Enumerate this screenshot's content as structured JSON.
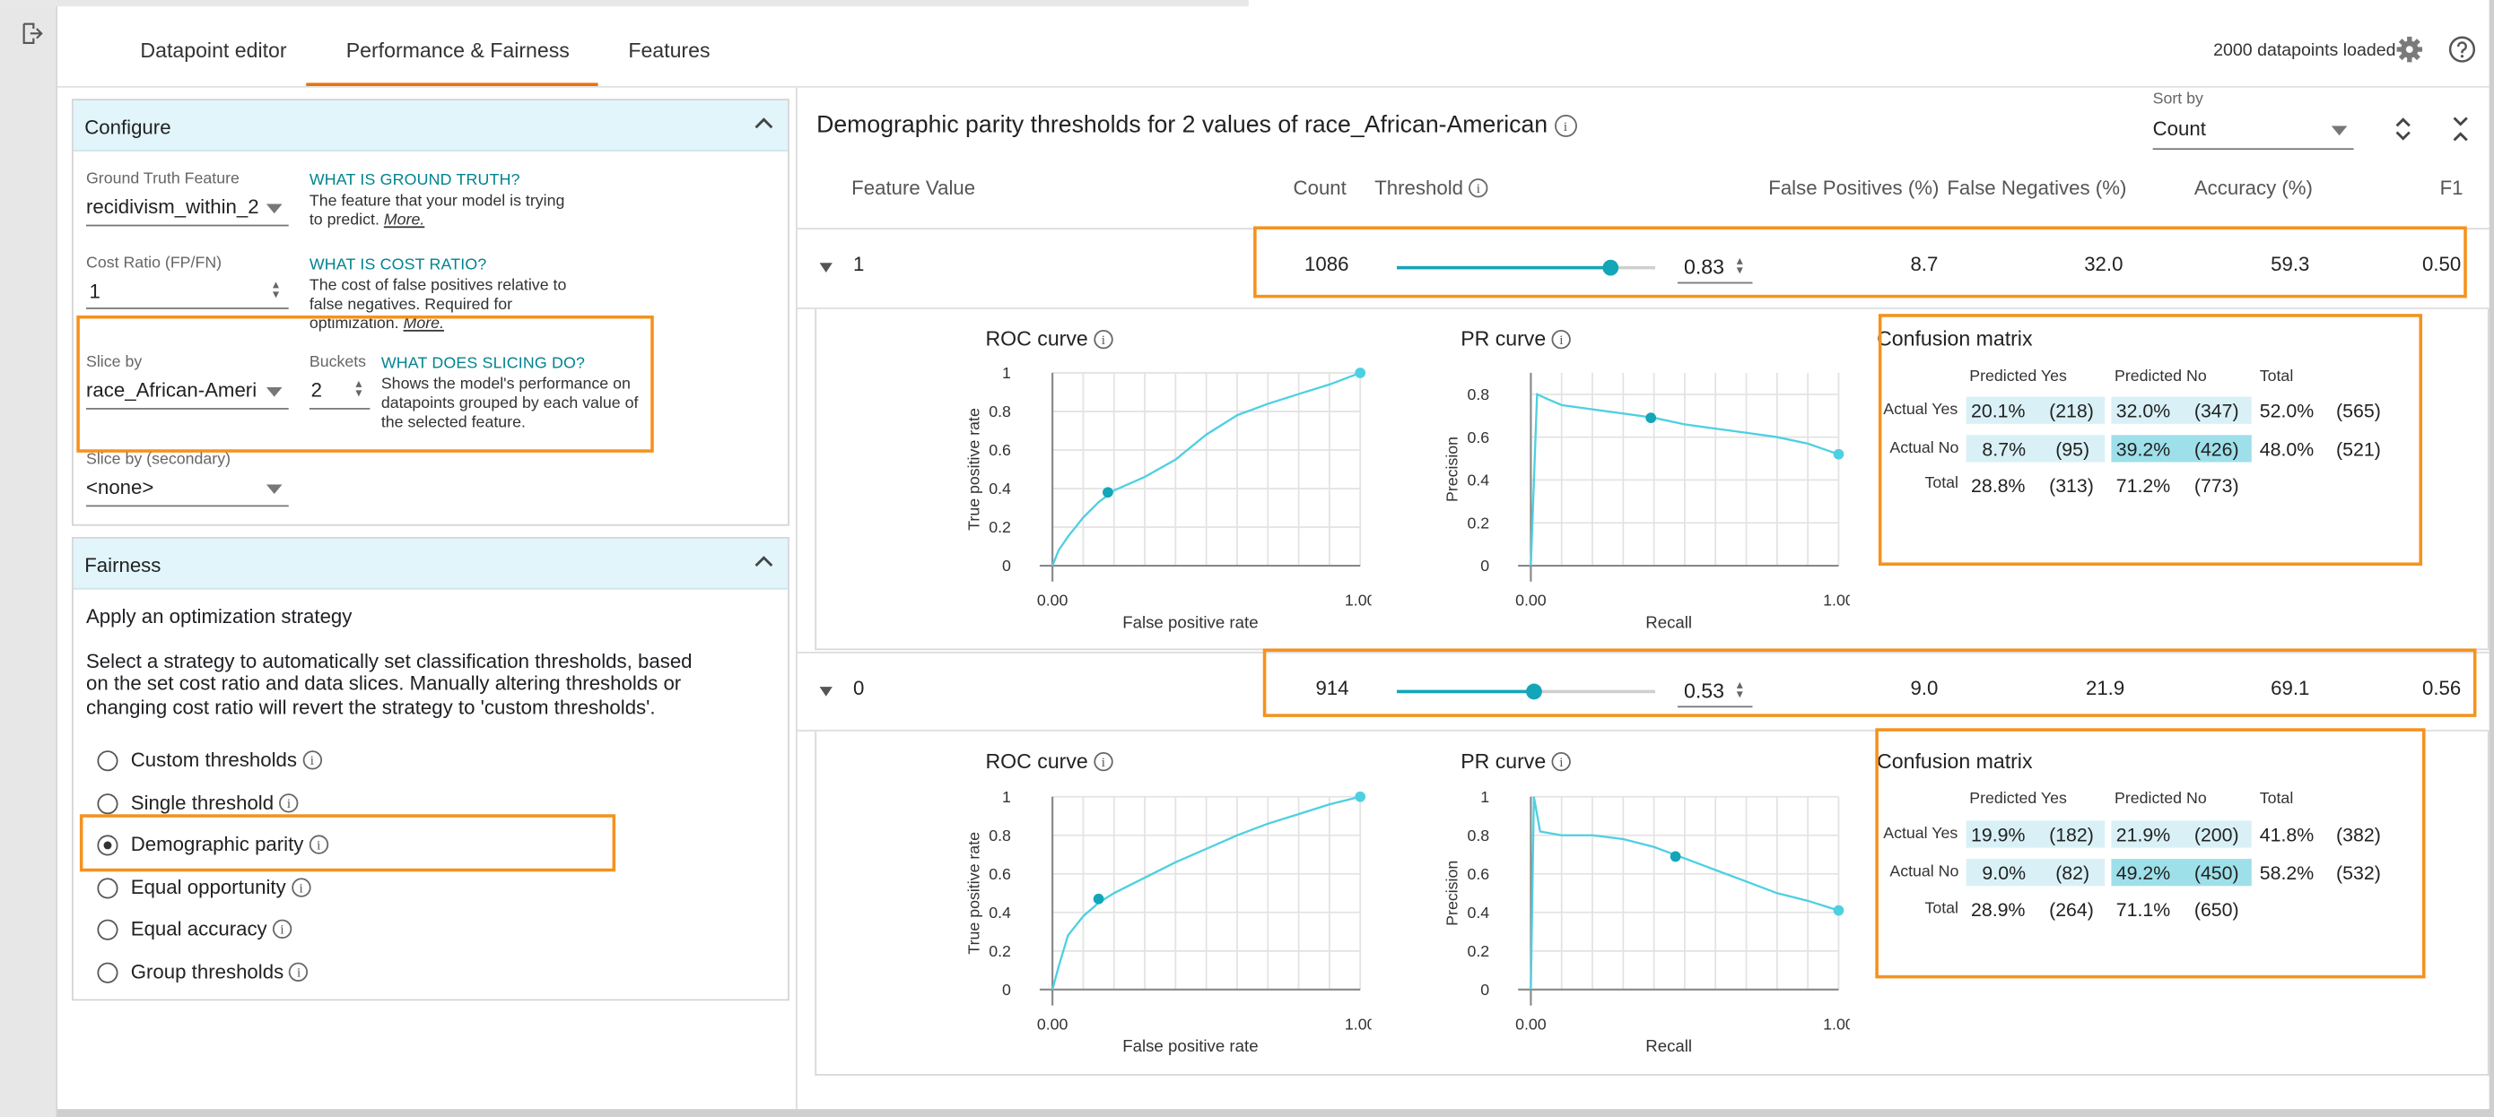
{
  "tabs": [
    "Datapoint editor",
    "Performance & Fairness",
    "Features"
  ],
  "status": "2000 datapoints loaded",
  "configure": {
    "title": "Configure",
    "ground_truth_label": "Ground Truth Feature",
    "ground_truth_value": "recidivism_within_2",
    "ground_truth_help_h": "WHAT IS GROUND TRUTH?",
    "ground_truth_help_1": "The feature that your model is trying",
    "ground_truth_help_2": "to predict.",
    "more": "More.",
    "cost_label": "Cost Ratio (FP/FN)",
    "cost_value": "1",
    "cost_help_h": "WHAT IS COST RATIO?",
    "cost_help_1": "The cost of false positives relative to",
    "cost_help_2": "false negatives. Required for",
    "cost_help_3": "optimization.",
    "slice_label": "Slice by",
    "slice_value": "race_African-Ameri",
    "buckets_label": "Buckets",
    "buckets_value": "2",
    "slice_help_h": "WHAT DOES SLICING DO?",
    "slice_help_1": "Shows the model's performance on",
    "slice_help_2": "datapoints grouped by each value of",
    "slice_help_3": "the selected feature.",
    "slice2_label": "Slice by (secondary)",
    "slice2_value": "<none>"
  },
  "fairness": {
    "title": "Fairness",
    "subtitle": "Apply an optimization strategy",
    "desc_1": "Select a strategy to automatically set classification thresholds, based",
    "desc_2": "on the set cost ratio and data slices. Manually altering thresholds or",
    "desc_3": "changing cost ratio will revert the strategy to 'custom thresholds'.",
    "options": [
      "Custom thresholds",
      "Single threshold",
      "Demographic parity",
      "Equal opportunity",
      "Equal accuracy",
      "Group thresholds"
    ],
    "selected": "Demographic parity"
  },
  "main": {
    "title": "Demographic parity thresholds for 2 values of race_African-American",
    "sort_label": "Sort by",
    "sort_value": "Count",
    "columns": [
      "Feature Value",
      "Count",
      "Threshold",
      "False Positives (%)",
      "False Negatives (%)",
      "Accuracy (%)",
      "F1"
    ],
    "rows": [
      {
        "feature_value": "1",
        "count": "1086",
        "threshold": "0.83",
        "threshold_level": 0.83,
        "fp": "8.7",
        "fn": "32.0",
        "accuracy": "59.3",
        "f1": "0.50",
        "roc_title": "ROC curve",
        "pr_title": "PR curve",
        "cm_title": "Confusion matrix",
        "cm": {
          "pred_yes": "Predicted Yes",
          "pred_no": "Predicted No",
          "total": "Total",
          "actual_yes": "Actual Yes",
          "actual_no": "Actual No",
          "total_row": "Total",
          "ay_py_pct": "20.1%",
          "ay_py_n": "(218)",
          "ay_pn_pct": "32.0%",
          "ay_pn_n": "(347)",
          "ay_t_pct": "52.0%",
          "ay_t_n": "(565)",
          "an_py_pct": "8.7%",
          "an_py_n": "(95)",
          "an_pn_pct": "39.2%",
          "an_pn_n": "(426)",
          "an_t_pct": "48.0%",
          "an_t_n": "(521)",
          "t_py_pct": "28.8%",
          "t_py_n": "(313)",
          "t_pn_pct": "71.2%",
          "t_pn_n": "(773)"
        }
      },
      {
        "feature_value": "0",
        "count": "914",
        "threshold": "0.53",
        "threshold_level": 0.53,
        "fp": "9.0",
        "fn": "21.9",
        "accuracy": "69.1",
        "f1": "0.56",
        "roc_title": "ROC curve",
        "pr_title": "PR curve",
        "cm_title": "Confusion matrix",
        "cm": {
          "pred_yes": "Predicted Yes",
          "pred_no": "Predicted No",
          "total": "Total",
          "actual_yes": "Actual Yes",
          "actual_no": "Actual No",
          "total_row": "Total",
          "ay_py_pct": "19.9%",
          "ay_py_n": "(182)",
          "ay_pn_pct": "21.9%",
          "ay_pn_n": "(200)",
          "ay_t_pct": "41.8%",
          "ay_t_n": "(382)",
          "an_py_pct": "9.0%",
          "an_py_n": "(82)",
          "an_pn_pct": "49.2%",
          "an_pn_n": "(450)",
          "an_t_pct": "58.2%",
          "an_t_n": "(532)",
          "t_py_pct": "28.9%",
          "t_py_n": "(264)",
          "t_pn_pct": "71.1%",
          "t_pn_n": "(650)"
        }
      }
    ]
  },
  "chart_data": [
    {
      "type": "line",
      "title": "ROC curve",
      "xlabel": "False positive rate",
      "ylabel": "True positive rate",
      "x_ticks": [
        "0.00",
        "1.00"
      ],
      "y_ticks": [
        "0",
        "0.2",
        "0.4",
        "0.6",
        "0.8",
        "1"
      ],
      "xlim": [
        0,
        1
      ],
      "ylim": [
        0,
        1
      ],
      "grid": true,
      "x": [
        0,
        0.02,
        0.05,
        0.1,
        0.15,
        0.2,
        0.3,
        0.4,
        0.5,
        0.6,
        0.7,
        0.8,
        0.9,
        1.0
      ],
      "y": [
        0,
        0.08,
        0.15,
        0.25,
        0.33,
        0.39,
        0.46,
        0.55,
        0.68,
        0.78,
        0.84,
        0.89,
        0.94,
        1.0
      ],
      "marker": [
        0.18,
        0.38
      ],
      "color": "#4dd0e1"
    },
    {
      "type": "line",
      "title": "PR curve",
      "xlabel": "Recall",
      "ylabel": "Precision",
      "x_ticks": [
        "0.00",
        "1.00"
      ],
      "y_ticks": [
        "0",
        "0.2",
        "0.4",
        "0.6",
        "0.8"
      ],
      "xlim": [
        0,
        1
      ],
      "ylim": [
        0,
        0.9
      ],
      "grid": true,
      "x": [
        0,
        0.02,
        0.05,
        0.1,
        0.2,
        0.3,
        0.4,
        0.5,
        0.6,
        0.7,
        0.8,
        0.9,
        1.0
      ],
      "y": [
        0,
        0.8,
        0.78,
        0.75,
        0.73,
        0.71,
        0.69,
        0.66,
        0.64,
        0.62,
        0.6,
        0.57,
        0.52
      ],
      "marker": [
        0.39,
        0.69
      ],
      "color": "#4dd0e1"
    },
    {
      "type": "line",
      "title": "ROC curve",
      "xlabel": "False positive rate",
      "ylabel": "True positive rate",
      "x_ticks": [
        "0.00",
        "1.00"
      ],
      "y_ticks": [
        "0",
        "0.2",
        "0.4",
        "0.6",
        "0.8",
        "1"
      ],
      "xlim": [
        0,
        1
      ],
      "ylim": [
        0,
        1
      ],
      "grid": true,
      "x": [
        0,
        0.02,
        0.05,
        0.1,
        0.15,
        0.2,
        0.3,
        0.4,
        0.5,
        0.6,
        0.7,
        0.8,
        0.9,
        1.0
      ],
      "y": [
        0,
        0.12,
        0.28,
        0.38,
        0.45,
        0.5,
        0.58,
        0.66,
        0.73,
        0.8,
        0.86,
        0.91,
        0.96,
        1.0
      ],
      "marker": [
        0.15,
        0.47
      ],
      "color": "#4dd0e1"
    },
    {
      "type": "line",
      "title": "PR curve",
      "xlabel": "Recall",
      "ylabel": "Precision",
      "x_ticks": [
        "0.00",
        "1.00"
      ],
      "y_ticks": [
        "0",
        "0.2",
        "0.4",
        "0.6",
        "0.8",
        "1"
      ],
      "xlim": [
        0,
        1
      ],
      "ylim": [
        0,
        1
      ],
      "grid": true,
      "x": [
        0,
        0.01,
        0.03,
        0.1,
        0.2,
        0.3,
        0.4,
        0.5,
        0.6,
        0.7,
        0.8,
        0.9,
        1.0
      ],
      "y": [
        0,
        1.0,
        0.82,
        0.8,
        0.8,
        0.78,
        0.74,
        0.68,
        0.62,
        0.56,
        0.5,
        0.46,
        0.41
      ],
      "marker": [
        0.47,
        0.69
      ],
      "color": "#4dd0e1"
    }
  ]
}
